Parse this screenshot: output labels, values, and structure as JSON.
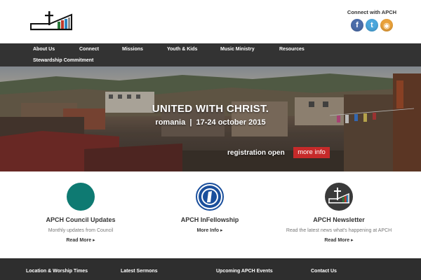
{
  "header": {
    "logo_name": "church-logo",
    "connect_title": "Connect with APCH",
    "social": [
      {
        "name": "facebook-icon",
        "glyph": "f"
      },
      {
        "name": "twitter-icon",
        "glyph": "t"
      },
      {
        "name": "rss-icon",
        "glyph": "◉"
      }
    ]
  },
  "nav": {
    "items": [
      "About Us",
      "Connect",
      "Missions",
      "Youth & Kids",
      "Music Ministry",
      "Resources",
      "Stewardship Commitment"
    ]
  },
  "hero": {
    "title": "UNITED WITH CHRIST.",
    "subtitle": "romania  |  17-24 october 2015",
    "registration": "registration open",
    "cta": "more info"
  },
  "features": [
    {
      "title": "APCH Council Updates",
      "desc": "Monthly updates from Council",
      "link": "Read More ▸"
    },
    {
      "title": "APCH InFellowship",
      "desc": "",
      "link": "More Info ▸"
    },
    {
      "title": "APCH Newsletter",
      "desc": "Read the latest news what's happening at APCH",
      "link": "Read More ▸"
    }
  ],
  "footer": {
    "columns": [
      "Location & Worship Times",
      "Latest Sermons",
      "Upcoming APCH Events",
      "Contact Us"
    ]
  },
  "colors": {
    "nav_bg": "#333333",
    "footer_bg": "#2e2e2e",
    "cta_red": "#c62a2a",
    "teal": "#0e7a72",
    "infellowship_blue": "#1a4f9c"
  }
}
